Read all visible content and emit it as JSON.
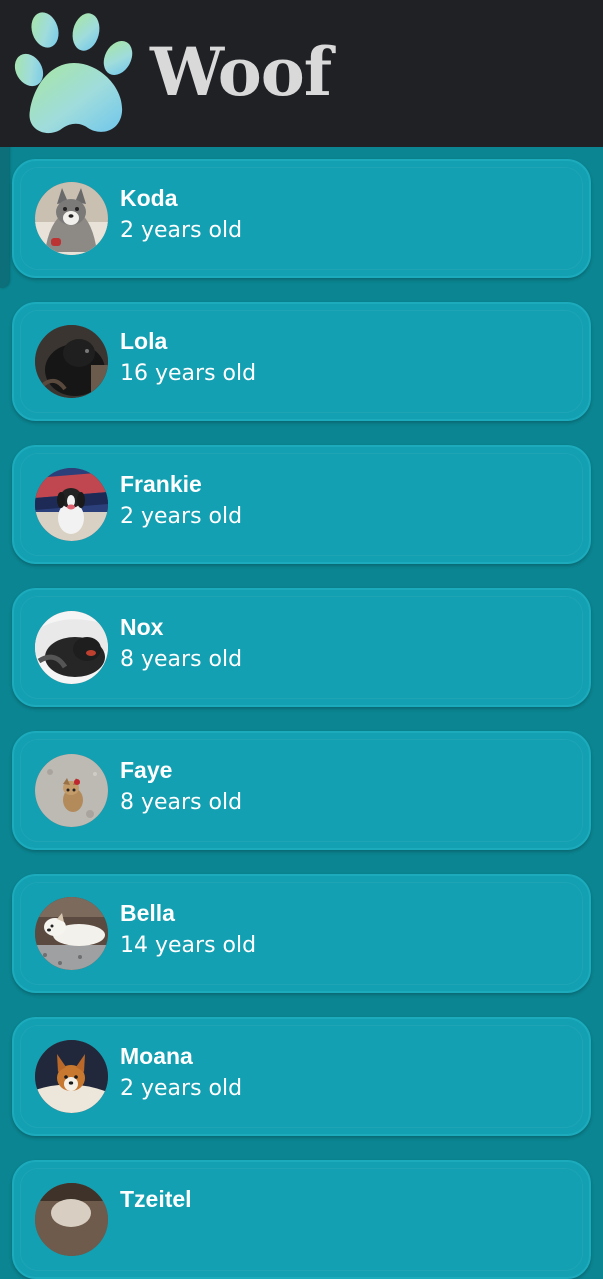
{
  "app": {
    "title": "Woof",
    "logo_icon": "paw-icon",
    "colors": {
      "app_bar": "#1f2125",
      "background": "#0b8591",
      "card": "#12a0b2",
      "text": "#ffffff"
    }
  },
  "dogs": [
    {
      "name": "Koda",
      "age": "2 years old",
      "photo": "koda-photo"
    },
    {
      "name": "Lola",
      "age": "16 years old",
      "photo": "lola-photo"
    },
    {
      "name": "Frankie",
      "age": "2 years old",
      "photo": "frankie-photo"
    },
    {
      "name": "Nox",
      "age": "8 years old",
      "photo": "nox-photo"
    },
    {
      "name": "Faye",
      "age": "8 years old",
      "photo": "faye-photo"
    },
    {
      "name": "Bella",
      "age": "14 years old",
      "photo": "bella-photo"
    },
    {
      "name": "Moana",
      "age": "2 years old",
      "photo": "moana-photo"
    },
    {
      "name": "Tzeitel",
      "age": "",
      "photo": "tzeitel-photo"
    }
  ]
}
